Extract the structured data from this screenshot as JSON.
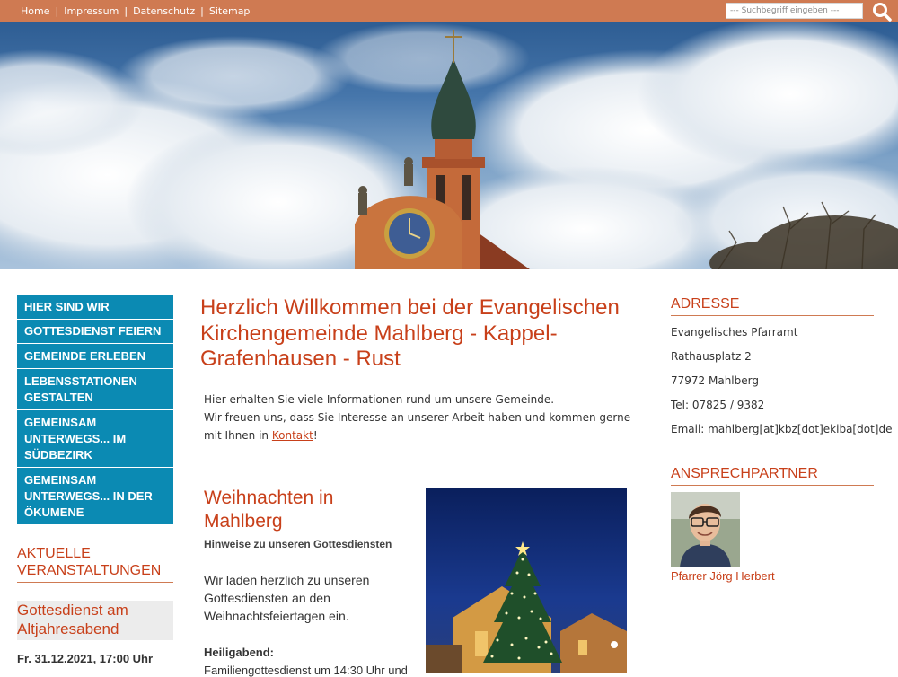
{
  "topnav": {
    "items": [
      "Home",
      "Impressum",
      "Datenschutz",
      "Sitemap"
    ],
    "separator": "|"
  },
  "search": {
    "placeholder": "--- Suchbegriff eingeben ---",
    "icon": "search-icon"
  },
  "colors": {
    "topbar": "#cf7a52",
    "accent": "#c8401a",
    "nav": "#0b8ab3"
  },
  "sidebar": {
    "nav": [
      "Hier sind wir",
      "Gottesdienst feiern",
      "Gemeinde erleben",
      "Lebensstationen gestalten",
      "Gemeinsam unterwegs... im Südbezirk",
      "Gemeinsam unterwegs... in der Ökumene"
    ],
    "events_heading": "Aktuelle Veranstaltungen",
    "event_title": "Gottesdienst am Altjahresabend",
    "event_date": "Fr. 31.12.2021, 17:00 Uhr"
  },
  "main": {
    "title": "Herzlich Willkommen bei der Evangelischen Kirchengemeinde Mahlberg - Kappel-Grafenhausen - Rust",
    "intro_line1": "Hier erhalten Sie viele Informationen rund um unsere Gemeinde.",
    "intro_line2": "Wir freuen uns, dass Sie Interesse an unserer Arbeit haben und kommen gerne mit Ihnen in",
    "intro_link": "Kontakt",
    "intro_end": "!",
    "news_title": "Weihnachten in Mahlberg",
    "news_subtitle": "Hinweise zu unseren Gottesdiensten",
    "news_body": "Wir laden herzlich zu unseren Gottesdiensten an den Weihnachtsfeiertagen ein.",
    "news_label": "Heiligabend:",
    "news_more": "Familiengottesdienst um 14:30 Uhr und"
  },
  "right": {
    "address_heading": "Adresse",
    "address": [
      "Evangelisches Pfarramt",
      "Rathausplatz 2",
      "77972 Mahlberg",
      "Tel: 07825 / 9382",
      "Email: mahlberg[at]kbz[dot]ekiba[dot]de"
    ],
    "contact_heading": "Ansprechpartner",
    "contact_name": "Pfarrer Jörg Herbert"
  }
}
